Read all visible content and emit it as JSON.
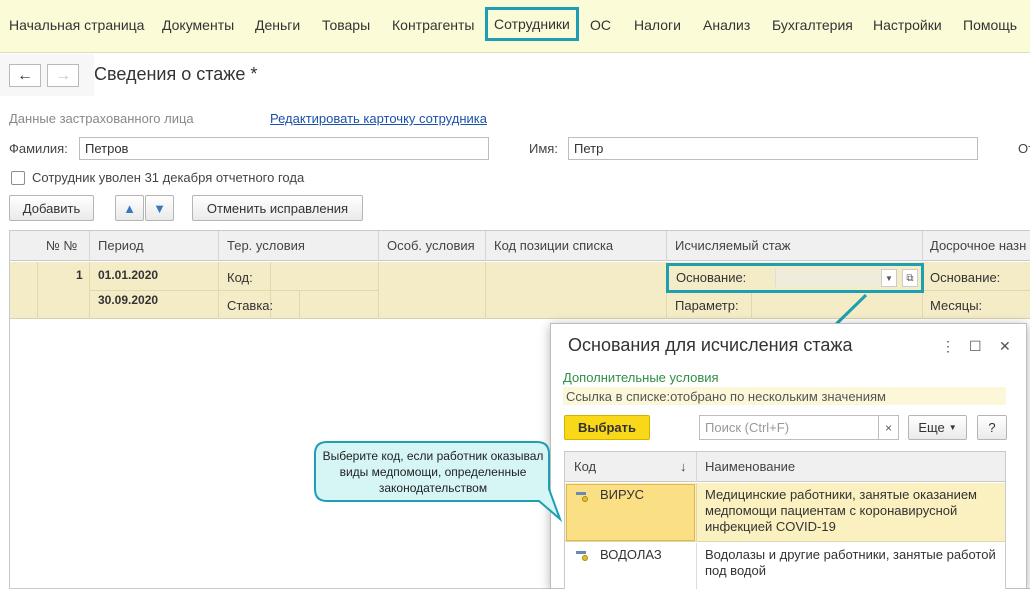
{
  "menu": {
    "items": [
      "Начальная страница",
      "Документы",
      "Деньги",
      "Товары",
      "Контрагенты",
      "Сотрудники",
      "ОС",
      "Налоги",
      "Анализ",
      "Бухгалтерия",
      "Настройки",
      "Помощь"
    ],
    "active": "Сотрудники"
  },
  "nav": {
    "back": "←",
    "forward": "→"
  },
  "page_title": "Сведения о стаже *",
  "insured": {
    "section_label": "Данные застрахованного лица",
    "edit_link": "Редактировать карточку сотрудника",
    "surname_label": "Фамилия:",
    "surname_value": "Петров",
    "name_label": "Имя:",
    "name_value": "Петр",
    "patronymic_label_cut": "От",
    "dismissed_label": "Сотрудник уволен 31 декабря отчетного года"
  },
  "buttons": {
    "add": "Добавить",
    "cancel_fix": "Отменить исправления"
  },
  "grid": {
    "headers": [
      "№ №",
      "Период",
      "Тер. условия",
      "Особ. условия",
      "Код позиции списка",
      "Исчисляемый стаж",
      "Досрочное назн"
    ],
    "row": {
      "num": "1",
      "date_from": "01.01.2020",
      "date_to": "30.09.2020",
      "code_label": "Код:",
      "rate_label": "Ставка:",
      "basis_label": "Основание:",
      "param_label": "Параметр:",
      "early_basis_label": "Основание:",
      "months_label": "Месяцы:"
    }
  },
  "dialog": {
    "title": "Основания для исчисления стажа",
    "more_icon": "⋮",
    "maximize_icon": "☐",
    "close_icon": "✕",
    "extra_conditions": "Дополнительные условия",
    "filter_text": "Ссылка в списке:отобрано по нескольким значениям",
    "select_button": "Выбрать",
    "search_placeholder": "Поиск (Ctrl+F)",
    "search_clear": "×",
    "more_button": "Еще",
    "help_button": "?",
    "columns": [
      "Код",
      "Наименование"
    ],
    "sort_indicator": "↓",
    "rows": [
      {
        "code": "ВИРУС",
        "name": "Медицинские работники, занятые оказанием медпомощи пациентам с коронавирусной инфекцией COVID-19"
      },
      {
        "code": "ВОДОЛАЗ",
        "name": "Водолазы и другие работники, занятые работой под водой"
      }
    ]
  },
  "callout": {
    "text": "Выберите код, если работник оказывал виды медпомощи, определенные законодательством"
  },
  "colors": {
    "accent": "#1d9fb1",
    "menu_bg": "#fbfbd8",
    "row_bg": "#f4ecc7",
    "select_button": "#f9d719",
    "callout_bg": "#d6f6f6"
  }
}
